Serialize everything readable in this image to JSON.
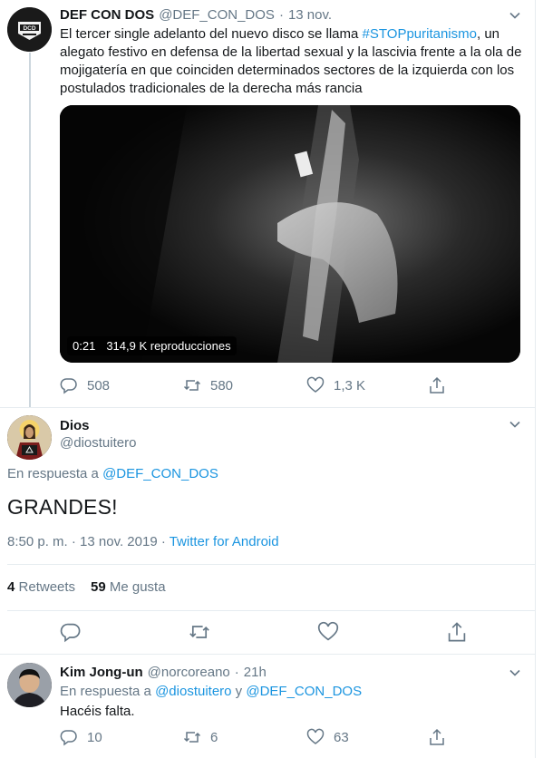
{
  "tweet1": {
    "name": "DEF CON DOS",
    "handle": "@DEF_CON_DOS",
    "separator": "·",
    "time": "13 nov.",
    "text_lines": {
      "l1_a": "El tercer single adelanto del nuevo disco se llama ",
      "l1_hashtag": "#STOPpuritanismo",
      "l1_b": ", un",
      "l2": "alegato festivo en defensa de la libertad sexual y la lascivia frente a la ola de",
      "l3": "mojigatería en que coinciden determinados sectores de la izquierda con los",
      "l4": "postulados tradicionales de la derecha más rancia"
    },
    "video": {
      "duration": "0:21",
      "views": "314,9 K reproducciones"
    },
    "actions": {
      "replies": "508",
      "retweets": "580",
      "likes": "1,3 K"
    },
    "avatar_icon": "def-con-dos-logo"
  },
  "tweet2": {
    "name": "Dios",
    "handle": "@diostuitero",
    "reply_prefix": "En respuesta a ",
    "reply_to": "@DEF_CON_DOS",
    "text": "GRANDES!",
    "timestamp": "8:50 p. m. · 13 nov. 2019 · ",
    "source": "Twitter for Android",
    "stats": {
      "retweets_count": "4",
      "retweets_label": "Retweets",
      "likes_count": "59",
      "likes_label": "Me gusta"
    }
  },
  "tweet3": {
    "name": "Kim Jong-un",
    "handle": "@norcoreano",
    "separator": "·",
    "time": "21h",
    "reply_prefix": "En respuesta a ",
    "reply_to_1": "@diostuitero",
    "reply_and": " y ",
    "reply_to_2": "@DEF_CON_DOS",
    "text": "Hacéis falta.",
    "actions": {
      "replies": "10",
      "retweets": "6",
      "likes": "63"
    }
  },
  "colors": {
    "link": "#1b95e0",
    "muted": "#657786",
    "text": "#14171a",
    "divider": "#e6ecf0"
  }
}
